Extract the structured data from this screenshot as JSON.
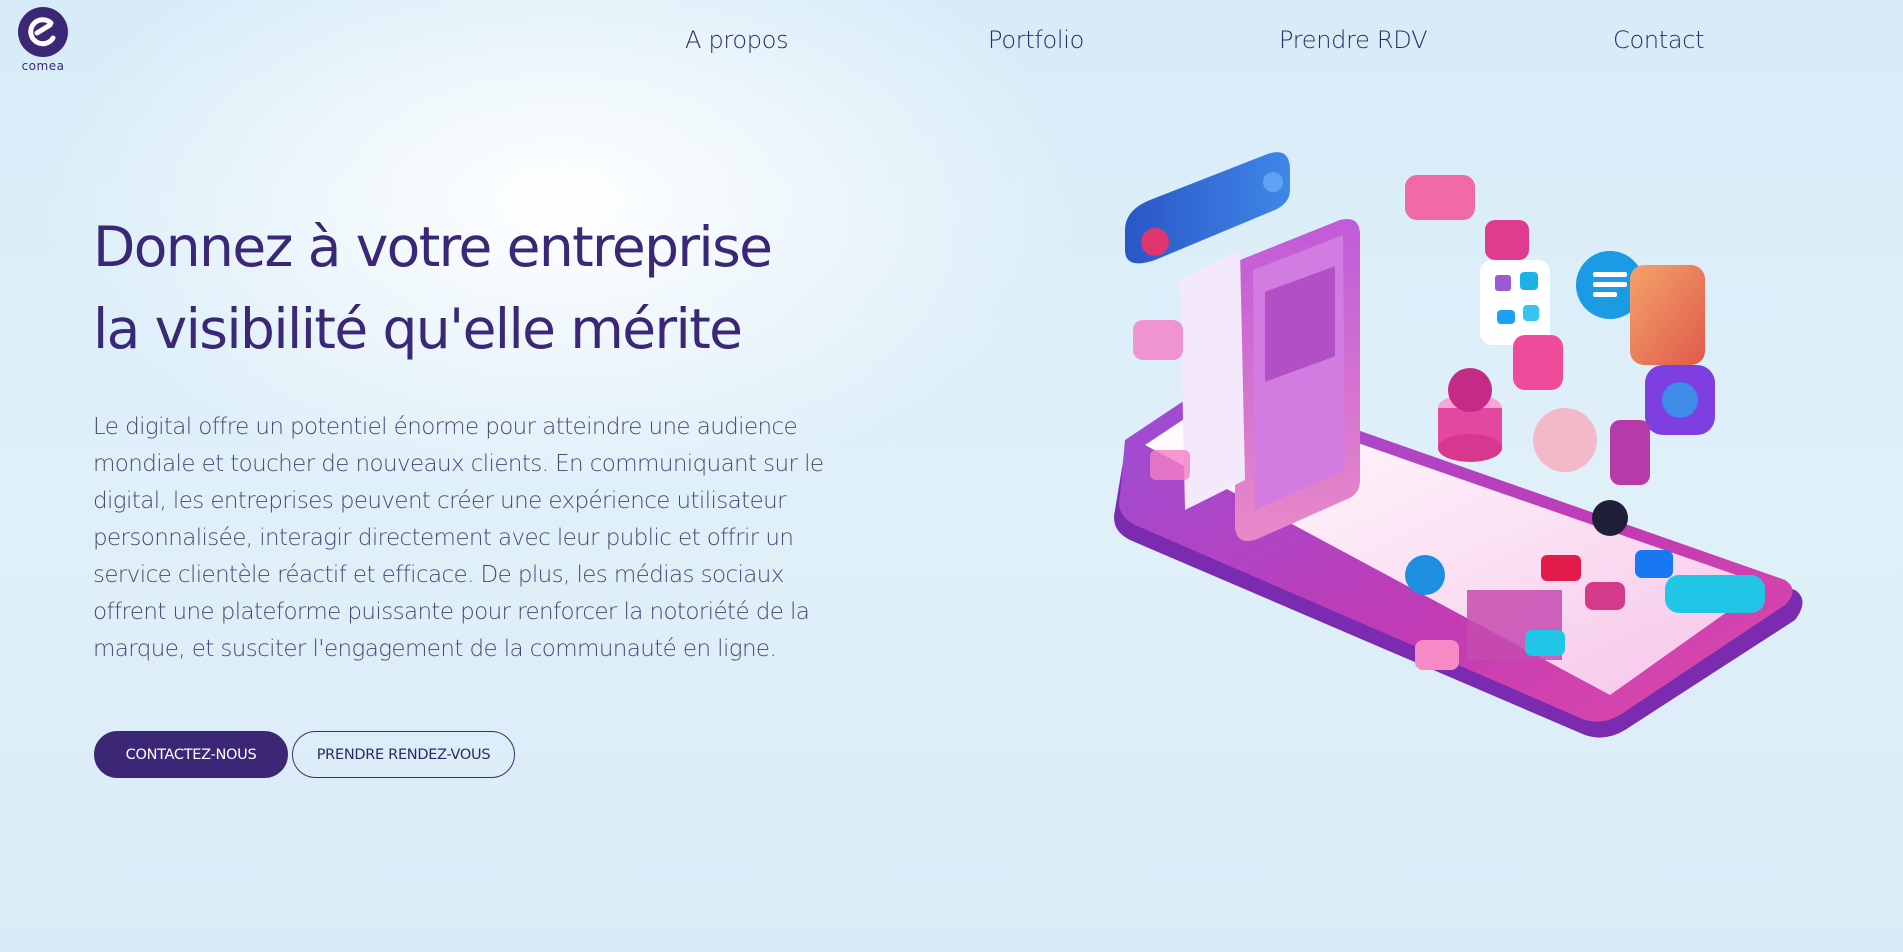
{
  "brand": {
    "name": "comea",
    "color": "#3b2775"
  },
  "nav": {
    "items": [
      {
        "label": "A propos"
      },
      {
        "label": "Portfolio"
      },
      {
        "label": "Prendre RDV"
      },
      {
        "label": "Contact"
      }
    ]
  },
  "hero": {
    "title": "Donnez à votre entreprise la visibilité qu'elle mérite",
    "text": "Le digital offre un potentiel énorme pour atteindre une audience mondiale et toucher de nouveaux clients. En communiquant sur le digital, les entreprises peuvent créer une expérience utilisateur personnalisée, interagir directement avec leur public et offrir un service clientèle réactif et efficace. De plus, les médias sociaux offrent une plateforme puissante pour renforcer la notoriété de la marque, et susciter l'engagement de la communauté en ligne.",
    "primary_button": "CONTACTEZ-NOUS",
    "secondary_button": "PRENDRE RENDEZ-VOUS"
  },
  "illustration": {
    "icon": "isometric-smartphone-social-media-illustration",
    "colors": {
      "magenta": "#c23bb4",
      "pink": "#f27fc4",
      "blue": "#2f73d8",
      "cyan": "#1cc8e8",
      "orange": "#f08a5d"
    }
  }
}
